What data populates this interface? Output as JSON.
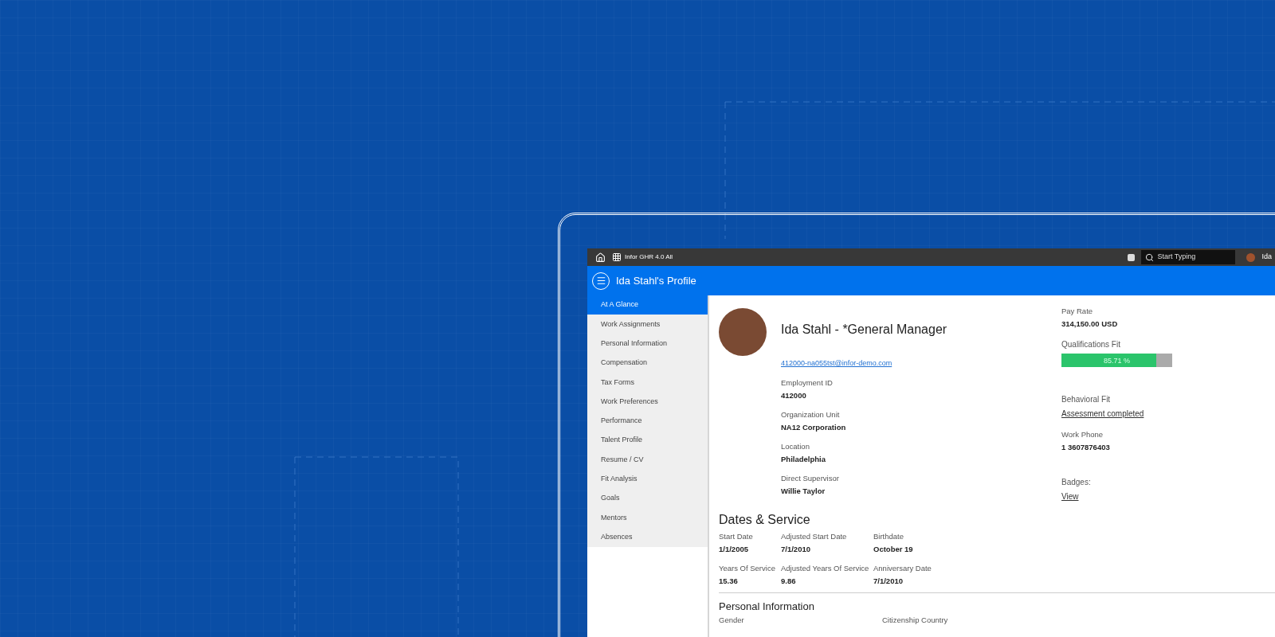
{
  "top_bar": {
    "app_name": "Infor GHR 4.0 All",
    "search": {
      "placeholder": "Start Typing"
    },
    "user_name": "Ida"
  },
  "header": {
    "title": "Ida Stahl's Profile"
  },
  "sidebar": {
    "items": [
      {
        "label": "At A Glance",
        "selected": true
      },
      {
        "label": "Work Assignments",
        "selected": false
      },
      {
        "label": "Personal Information",
        "selected": false
      },
      {
        "label": "Compensation",
        "selected": false
      },
      {
        "label": "Tax Forms",
        "selected": false
      },
      {
        "label": "Work Preferences",
        "selected": false
      },
      {
        "label": "Performance",
        "selected": false
      },
      {
        "label": "Talent Profile",
        "selected": false
      },
      {
        "label": "Resume / CV",
        "selected": false
      },
      {
        "label": "Fit Analysis",
        "selected": false
      },
      {
        "label": "Goals",
        "selected": false
      },
      {
        "label": "Mentors",
        "selected": false
      },
      {
        "label": "Absences",
        "selected": false
      }
    ]
  },
  "profile": {
    "name": "Ida Stahl - *General Manager",
    "email": "412000-na055tst@infor-demo.com",
    "fields": [
      {
        "label": "Employment ID",
        "value": "412000"
      },
      {
        "label": "Organization Unit",
        "value": "NA12 Corporation"
      },
      {
        "label": "Location",
        "value": "Philadelphia"
      },
      {
        "label": "Direct Supervisor",
        "value": "Willie Taylor"
      }
    ]
  },
  "summary": {
    "pay_rate": {
      "label": "Pay Rate",
      "value": "314,150.00 USD"
    },
    "qualifications_fit": {
      "label": "Qualifications Fit",
      "level": 0.8571,
      "reading": "85.71 %"
    },
    "behavioral_fit": {
      "label": "Behavioral Fit",
      "link": "Assessment completed"
    },
    "work_phone": {
      "label": "Work Phone",
      "value": "1 3607876403"
    },
    "badges": {
      "label": "Badges:",
      "link": "View"
    }
  },
  "dates_service": {
    "title": "Dates & Service",
    "fields": [
      {
        "label": "Start Date",
        "value": "1/1/2005"
      },
      {
        "label": "Adjusted Start Date",
        "value": "7/1/2010"
      },
      {
        "label": "Birthdate",
        "value": "October 19"
      },
      {
        "label": "Years Of Service",
        "value": "15.36"
      },
      {
        "label": "Adjusted Years Of Service",
        "value": "9.86"
      },
      {
        "label": "Anniversary Date",
        "value": "7/1/2010"
      }
    ]
  },
  "personal_information": {
    "title": "Personal Information",
    "labels": [
      "Gender",
      "Citizenship Country"
    ]
  }
}
